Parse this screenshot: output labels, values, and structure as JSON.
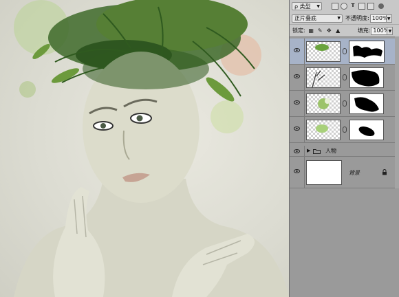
{
  "layers_panel": {
    "filter_kind": "ρ 类型",
    "blend_mode": "正片叠底",
    "opacity_label": "不透明度:",
    "opacity_value": "100%",
    "lock_label": "锁定:",
    "fill_label": "填充:",
    "fill_value": "100%",
    "group_name": "人物",
    "background_name": "背景"
  },
  "icons": {
    "filter_type": "filter-icon",
    "eye": "eye-icon",
    "chain": "link-icon",
    "folder": "folder-icon",
    "lock": "lock-icon"
  },
  "colors": {
    "panel_bg": "#9a9a9a",
    "toolbar_bg": "#c8c8c8",
    "selected_layer": "#a7b3c8"
  }
}
